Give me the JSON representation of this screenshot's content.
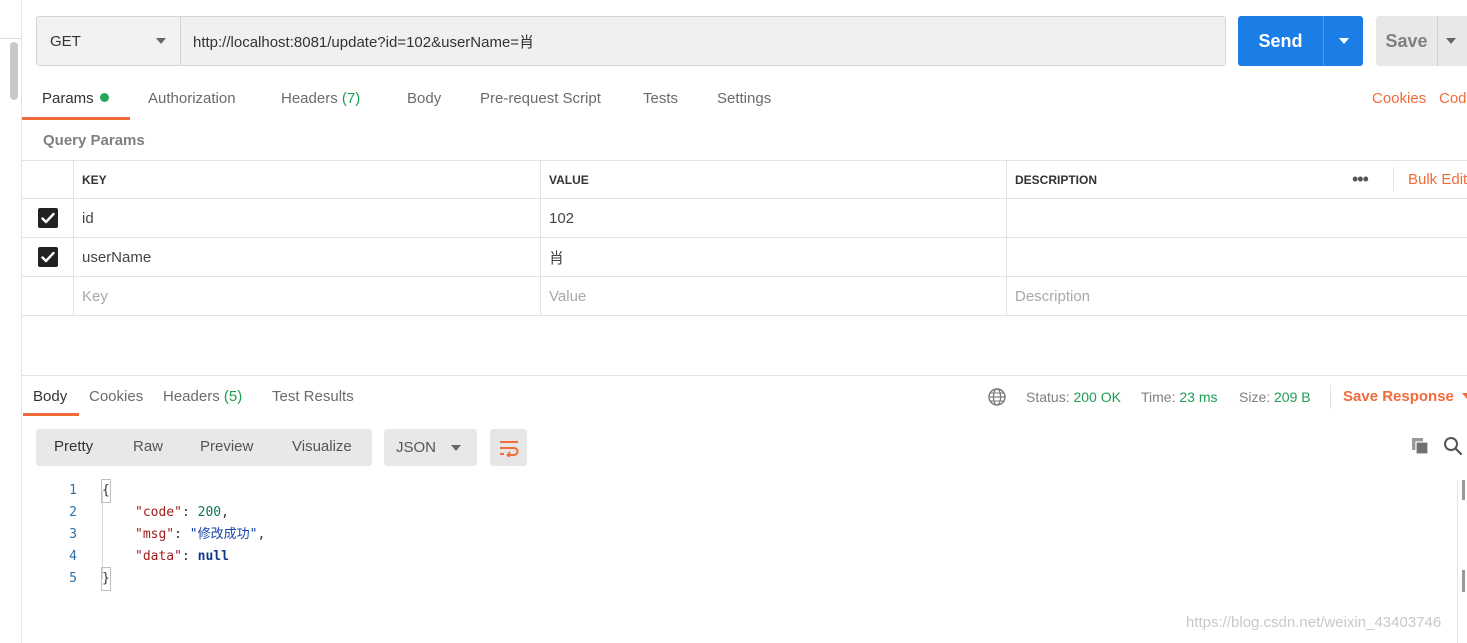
{
  "request": {
    "method": "GET",
    "url": "http://localhost:8081/update?id=102&userName=肖",
    "send_label": "Send",
    "save_label": "Save"
  },
  "request_tabs": {
    "params": "Params",
    "authorization": "Authorization",
    "headers": "Headers",
    "headers_count": "(7)",
    "body": "Body",
    "prerequest": "Pre-request Script",
    "tests": "Tests",
    "settings": "Settings",
    "cookies": "Cookies",
    "code": "Code"
  },
  "query_params": {
    "title": "Query Params",
    "columns": {
      "key": "KEY",
      "value": "VALUE",
      "description": "DESCRIPTION"
    },
    "more": "•••",
    "bulk_edit": "Bulk Edit",
    "rows": [
      {
        "checked": true,
        "key": "id",
        "value": "102",
        "description": ""
      },
      {
        "checked": true,
        "key": "userName",
        "value": "肖",
        "description": ""
      }
    ],
    "placeholder": {
      "key": "Key",
      "value": "Value",
      "description": "Description"
    }
  },
  "response_tabs": {
    "body": "Body",
    "cookies": "Cookies",
    "headers": "Headers",
    "headers_count": "(5)",
    "test_results": "Test Results"
  },
  "response_meta": {
    "status_label": "Status:",
    "status_value": "200 OK",
    "time_label": "Time:",
    "time_value": "23 ms",
    "size_label": "Size:",
    "size_value": "209 B",
    "save_response": "Save Response"
  },
  "view_modes": {
    "pretty": "Pretty",
    "raw": "Raw",
    "preview": "Preview",
    "visualize": "Visualize",
    "format": "JSON"
  },
  "code": {
    "line_numbers": [
      "1",
      "2",
      "3",
      "4",
      "5"
    ],
    "open_brace": "{",
    "close_brace": "}",
    "k_code": "\"code\"",
    "v_code": "200",
    "k_msg": "\"msg\"",
    "v_msg": "\"修改成功\"",
    "k_data": "\"data\"",
    "v_data": "null",
    "colon": ": ",
    "comma": ","
  },
  "watermark": "https://blog.csdn.net/weixin_43403746"
}
